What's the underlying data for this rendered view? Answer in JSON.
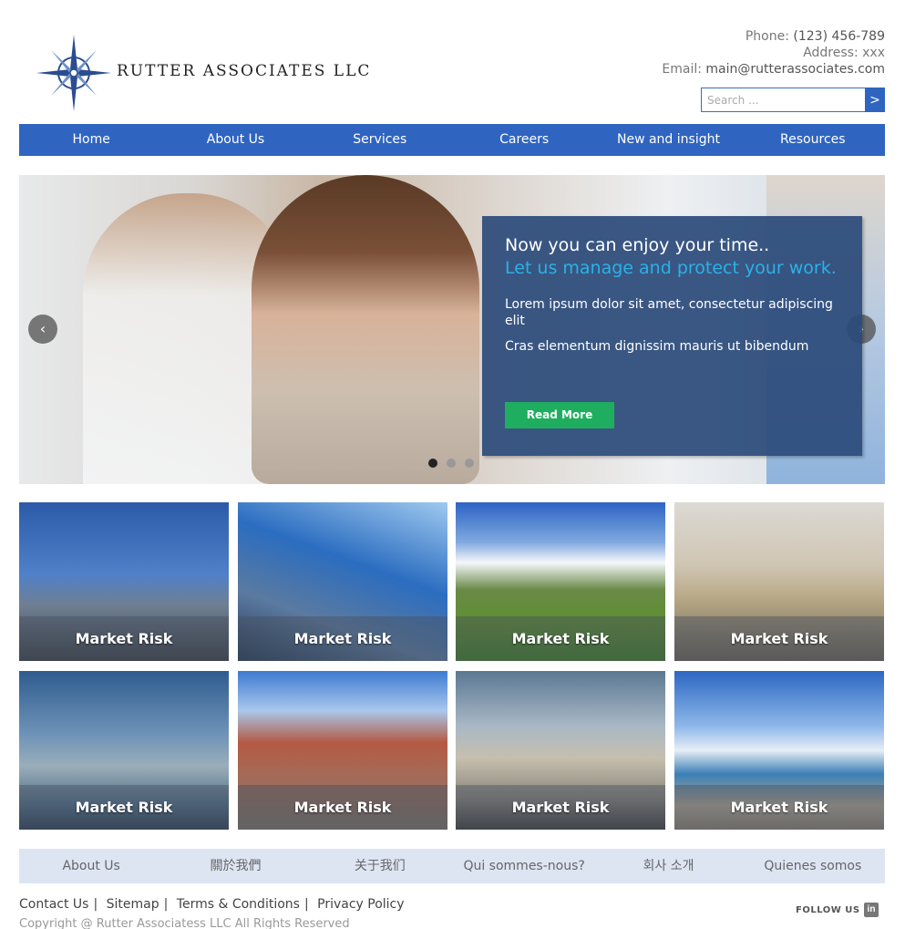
{
  "brand": {
    "name": "RUTTER ASSOCIATES LLC",
    "accent": "#2f65c1"
  },
  "contact": {
    "phone_label": "Phone:",
    "phone": "(123) 456-789",
    "address_label": "Address:",
    "address": "xxx",
    "email_label": "Email:",
    "email": "main@rutterassociates.com"
  },
  "search": {
    "placeholder": "Search ...",
    "button": ">"
  },
  "nav": [
    {
      "label": "Home"
    },
    {
      "label": "About Us"
    },
    {
      "label": "Services"
    },
    {
      "label": "Careers"
    },
    {
      "label": "New and insight"
    },
    {
      "label": "Resources"
    }
  ],
  "hero": {
    "title": "Now you can enjoy your time..",
    "subtitle": "Let us manage and protect your work.",
    "text1": "Lorem ipsum dolor sit amet, consectetur adipiscing elit",
    "text2": "Cras elementum dignissim mauris ut bibendum",
    "button": "Read More",
    "prev": "‹",
    "next": "›",
    "slides": 3,
    "active_slide": 1
  },
  "tiles": [
    {
      "label": "Market Risk"
    },
    {
      "label": "Market Risk"
    },
    {
      "label": "Market Risk"
    },
    {
      "label": "Market Risk"
    },
    {
      "label": "Market Risk"
    },
    {
      "label": "Market Risk"
    },
    {
      "label": "Market Risk"
    },
    {
      "label": "Market Risk"
    }
  ],
  "languages": [
    {
      "label": "About Us"
    },
    {
      "label": "關於我們"
    },
    {
      "label": "关于我们"
    },
    {
      "label": "Qui sommes-nous?"
    },
    {
      "label": "회사 소개"
    },
    {
      "label": "Quienes somos"
    }
  ],
  "footer": {
    "links": [
      {
        "label": "Contact Us"
      },
      {
        "label": "Sitemap"
      },
      {
        "label": "Terms & Conditions"
      },
      {
        "label": "Privacy Policy"
      }
    ],
    "separator": "|",
    "copyright": "Copyright @ Rutter Associatess LLC All Rights Reserved",
    "follow": "FOLLOW US",
    "linkedin": "in"
  }
}
